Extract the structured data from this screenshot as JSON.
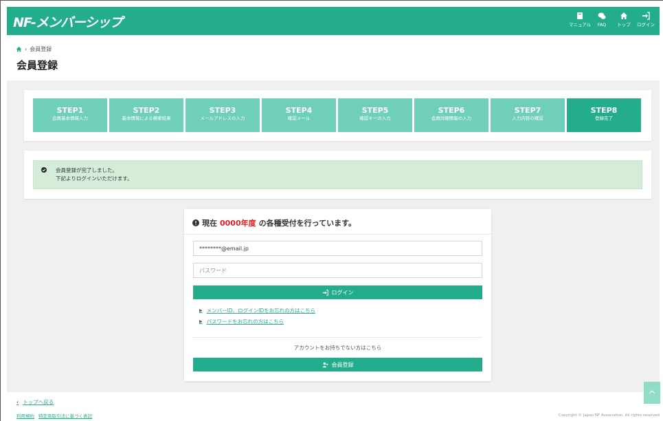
{
  "header": {
    "logo": "NF-メンバーシップ",
    "nav": [
      {
        "icon": "book-icon",
        "label": "マニュアル"
      },
      {
        "icon": "chat-icon",
        "label": "FAQ"
      },
      {
        "icon": "home-icon",
        "label": "トップ"
      },
      {
        "icon": "login-icon",
        "label": "ログイン"
      }
    ]
  },
  "breadcrumb": {
    "current": "会員登録"
  },
  "page_title": "会員登録",
  "steps": [
    {
      "num": "STEP1",
      "desc": "会員基本情報入力"
    },
    {
      "num": "STEP2",
      "desc": "基本情報による検索結果"
    },
    {
      "num": "STEP3",
      "desc": "メールアドレスの入力"
    },
    {
      "num": "STEP4",
      "desc": "確認メール"
    },
    {
      "num": "STEP5",
      "desc": "確認キーの入力"
    },
    {
      "num": "STEP6",
      "desc": "会員詳細情報の入力"
    },
    {
      "num": "STEP7",
      "desc": "入力内容の確認"
    },
    {
      "num": "STEP8",
      "desc": "登録完了"
    }
  ],
  "alert": {
    "line1": "会員登録が完了しました。",
    "line2": "下記よりログインいただけます。"
  },
  "login": {
    "heading_pre": "現在",
    "heading_year": "0000年度",
    "heading_post": "の各種受付を行っています。",
    "email_value": "********@email.jp",
    "password_placeholder": "パスワード",
    "login_button": "ログイン",
    "link_forgot_id": "メンバーID、ログインIDをお忘れの方はこちら",
    "link_forgot_pw": "パスワードをお忘れの方はこちら",
    "no_account": "アカウントをお持ちでない方はこちら",
    "register_button": "会員登録"
  },
  "footer": {
    "back_to_top": "トップへ戻る",
    "terms": "利用規約",
    "law": "特定商取引法に基づく表記",
    "copyright": "Copyright © Japan NF Association. All rights reserved"
  },
  "colors": {
    "brand": "#23ad8c",
    "step_inactive": "#6fcfb8",
    "alert_bg": "#d5ecd9",
    "highlight": "#e61e1e"
  }
}
